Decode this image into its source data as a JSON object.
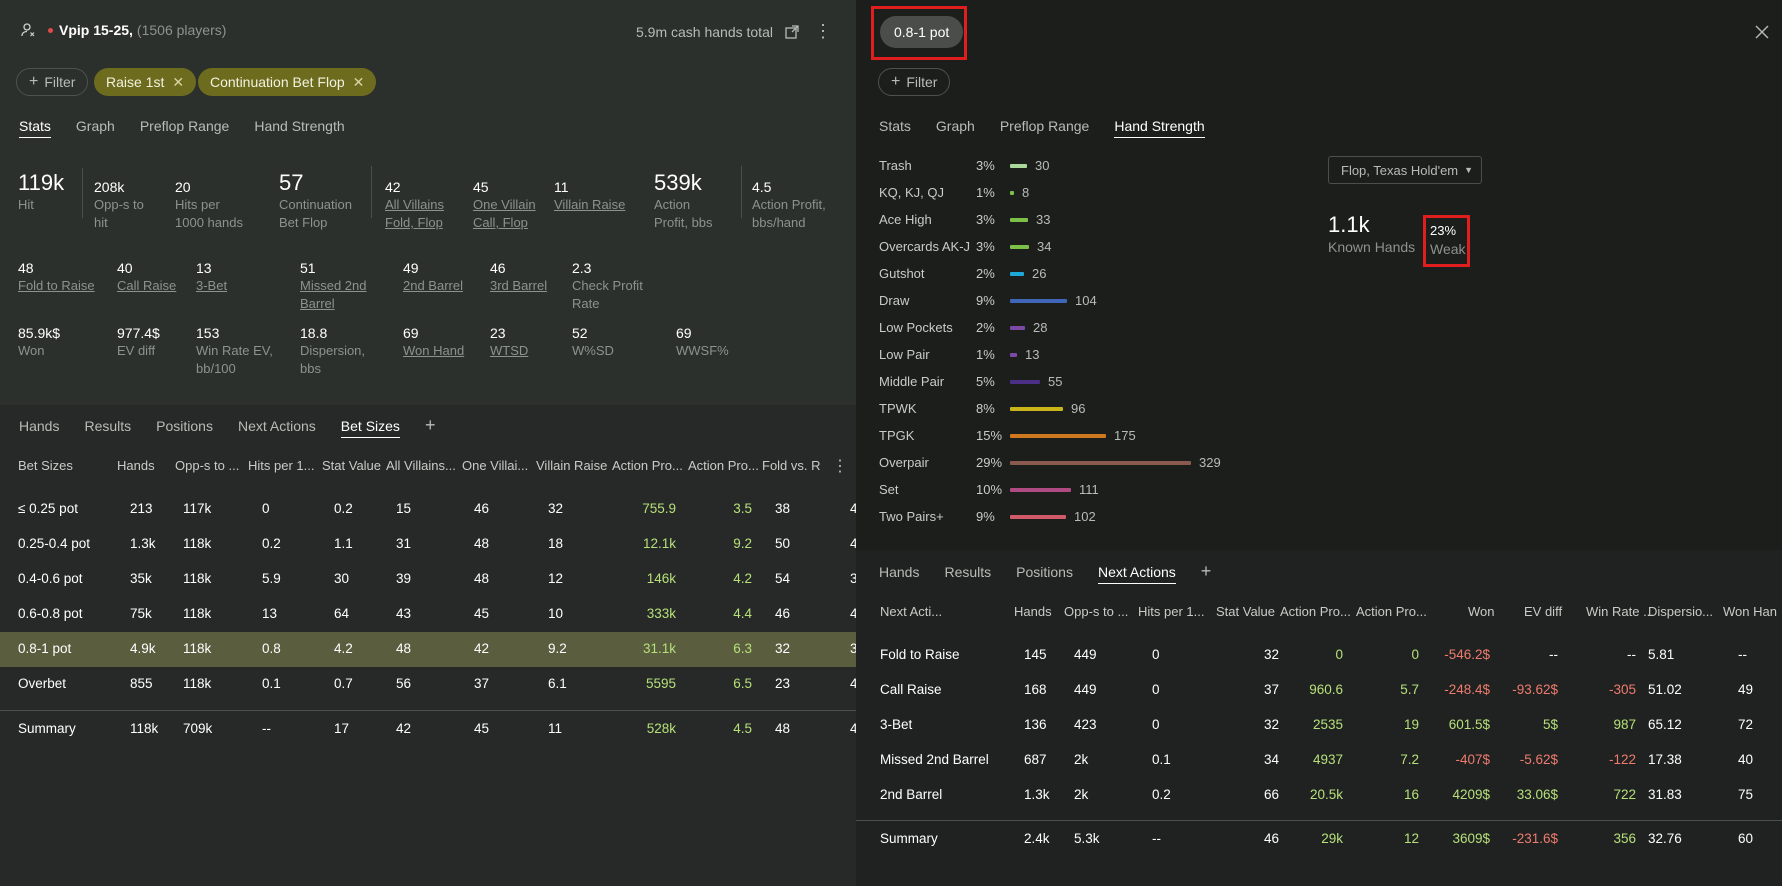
{
  "left": {
    "header": {
      "title": "Vpip 15-25,",
      "subtitle": "(1506 players)",
      "hands_total": "5.9m cash hands total"
    },
    "filter_label": "Filter",
    "chips": [
      "Raise 1st",
      "Continuation Bet Flop"
    ],
    "tabs": [
      "Stats",
      "Graph",
      "Preflop Range",
      "Hand Strength"
    ],
    "stats_row1": [
      {
        "v": "119k",
        "l": [
          "Hit"
        ]
      },
      {
        "v": "208k",
        "l": [
          "Opp-s to",
          "hit"
        ]
      },
      {
        "v": "20",
        "l": [
          "Hits per",
          "1000 hands"
        ]
      },
      {
        "v": "57",
        "l": [
          "Continuation",
          "Bet Flop"
        ]
      },
      {
        "v": "42",
        "l": [
          "All Villains",
          "Fold, Flop"
        ]
      },
      {
        "v": "45",
        "l": [
          "One Villain",
          "Call, Flop"
        ]
      },
      {
        "v": "11",
        "l": [
          "Villain Raise"
        ]
      },
      {
        "v": "539k",
        "l": [
          "Action",
          "Profit, bbs"
        ]
      },
      {
        "v": "4.5",
        "l": [
          "Action Profit,",
          "bbs/hand"
        ]
      }
    ],
    "stats_row2": [
      {
        "v": "48",
        "l": [
          "Fold to Raise"
        ]
      },
      {
        "v": "40",
        "l": [
          "Call Raise"
        ]
      },
      {
        "v": "13",
        "l": [
          "3-Bet"
        ]
      },
      {
        "v": "51",
        "l": [
          "Missed 2nd",
          "Barrel"
        ]
      },
      {
        "v": "49",
        "l": [
          "2nd Barrel"
        ]
      },
      {
        "v": "46",
        "l": [
          "3rd Barrel"
        ]
      },
      {
        "v": "2.3",
        "l": [
          "Check Profit",
          "Rate"
        ]
      }
    ],
    "stats_row3": [
      {
        "v": "85.9k$",
        "l": [
          "Won"
        ]
      },
      {
        "v": "977.4$",
        "l": [
          "EV diff"
        ]
      },
      {
        "v": "153",
        "l": [
          "Win Rate EV,",
          "bb/100"
        ]
      },
      {
        "v": "18.8",
        "l": [
          "Dispersion,",
          "bbs"
        ]
      },
      {
        "v": "69",
        "l": [
          "Won Hand"
        ]
      },
      {
        "v": "23",
        "l": [
          "WTSD"
        ]
      },
      {
        "v": "52",
        "l": [
          "W%SD"
        ]
      },
      {
        "v": "69",
        "l": [
          "WWSF%"
        ]
      }
    ],
    "subtabs": [
      "Hands",
      "Results",
      "Positions",
      "Next Actions",
      "Bet Sizes"
    ],
    "columns": [
      "Bet Sizes",
      "Hands",
      "Opp-s to ...",
      "Hits per 1...",
      "Stat Value",
      "All Villains...",
      "One Villai...",
      "Villain Raise",
      "Action Pro...",
      "Action Pro...",
      "Fold vs. R"
    ],
    "rows": [
      [
        "≤ 0.25 pot",
        "213",
        "117k",
        "0",
        "0.2",
        "15",
        "46",
        "32",
        "755.9",
        "3.5",
        "38",
        "4"
      ],
      [
        "0.25-0.4 pot",
        "1.3k",
        "118k",
        "0.2",
        "1.1",
        "31",
        "48",
        "18",
        "12.1k",
        "9.2",
        "50",
        "4"
      ],
      [
        "0.4-0.6 pot",
        "35k",
        "118k",
        "5.9",
        "30",
        "39",
        "48",
        "12",
        "146k",
        "4.2",
        "54",
        "3"
      ],
      [
        "0.6-0.8 pot",
        "75k",
        "118k",
        "13",
        "64",
        "43",
        "45",
        "10",
        "333k",
        "4.4",
        "46",
        "4"
      ],
      [
        "0.8-1 pot",
        "4.9k",
        "118k",
        "0.8",
        "4.2",
        "48",
        "42",
        "9.2",
        "31.1k",
        "6.3",
        "32",
        "3"
      ],
      [
        "Overbet",
        "855",
        "118k",
        "0.1",
        "0.7",
        "56",
        "37",
        "6.1",
        "5595",
        "6.5",
        "23",
        "4"
      ]
    ],
    "summary": [
      "Summary",
      "118k",
      "709k",
      "--",
      "17",
      "42",
      "45",
      "11",
      "528k",
      "4.5",
      "48",
      "4"
    ]
  },
  "right": {
    "pot_chip": "0.8-1 pot",
    "filter_label": "Filter",
    "tabs": [
      "Stats",
      "Graph",
      "Preflop Range",
      "Hand Strength"
    ],
    "hand_strength": [
      {
        "label": "Trash",
        "pct": "3%",
        "count": 30,
        "color": "#a9d89a"
      },
      {
        "label": "KQ, KJ, QJ",
        "pct": "1%",
        "count": 8,
        "color": "#7cc04a"
      },
      {
        "label": "Ace High",
        "pct": "3%",
        "count": 33,
        "color": "#7cc04a"
      },
      {
        "label": "Overcards AK-J",
        "pct": "3%",
        "count": 34,
        "color": "#7cc04a"
      },
      {
        "label": "Gutshot",
        "pct": "2%",
        "count": 26,
        "color": "#1ea8d6"
      },
      {
        "label": "Draw",
        "pct": "9%",
        "count": 104,
        "color": "#3f66b8"
      },
      {
        "label": "Low Pockets",
        "pct": "2%",
        "count": 28,
        "color": "#7a4aa6"
      },
      {
        "label": "Low Pair",
        "pct": "1%",
        "count": 13,
        "color": "#7a4aa6"
      },
      {
        "label": "Middle Pair",
        "pct": "5%",
        "count": 55,
        "color": "#4b2e86"
      },
      {
        "label": "TPWK",
        "pct": "8%",
        "count": 96,
        "color": "#c9b41a"
      },
      {
        "label": "TPGK",
        "pct": "15%",
        "count": 175,
        "color": "#d07820"
      },
      {
        "label": "Overpair",
        "pct": "29%",
        "count": 329,
        "color": "#8a5a4e"
      },
      {
        "label": "Set",
        "pct": "10%",
        "count": 111,
        "color": "#b04a82"
      },
      {
        "label": "Two Pairs+",
        "pct": "9%",
        "count": 102,
        "color": "#d05a6a"
      }
    ],
    "dropdown": "Flop, Texas Hold'em",
    "known_hands": {
      "value": "1.1k",
      "label": "Known Hands"
    },
    "weak": {
      "value": "23%",
      "label": "Weak"
    },
    "subtabs": [
      "Hands",
      "Results",
      "Positions",
      "Next Actions"
    ],
    "columns": [
      "Next Acti...",
      "Hands",
      "Opp-s to ...",
      "Hits per 1...",
      "Stat Value",
      "Action Pro...",
      "Action Pro...",
      "Won",
      "EV diff",
      "Win Rate ...",
      "Dispersio...",
      "Won Han"
    ],
    "rows": [
      [
        "Fold to Raise",
        "145",
        "449",
        "0",
        "32",
        "0",
        "0",
        "-546.2$",
        "--",
        "--",
        "5.81",
        "--"
      ],
      [
        "Call Raise",
        "168",
        "449",
        "0",
        "37",
        "960.6",
        "5.7",
        "-248.4$",
        "-93.62$",
        "-305",
        "51.02",
        "49"
      ],
      [
        "3-Bet",
        "136",
        "423",
        "0",
        "32",
        "2535",
        "19",
        "601.5$",
        "5$",
        "987",
        "65.12",
        "72"
      ],
      [
        "Missed 2nd Barrel",
        "687",
        "2k",
        "0.1",
        "34",
        "4937",
        "7.2",
        "-407$",
        "-5.62$",
        "-122",
        "17.38",
        "40"
      ],
      [
        "2nd Barrel",
        "1.3k",
        "2k",
        "0.2",
        "66",
        "20.5k",
        "16",
        "4209$",
        "33.06$",
        "722",
        "31.83",
        "75"
      ]
    ],
    "summary": [
      "Summary",
      "2.4k",
      "5.3k",
      "--",
      "46",
      "29k",
      "12",
      "3609$",
      "-231.6$",
      "356",
      "32.76",
      "60"
    ]
  }
}
